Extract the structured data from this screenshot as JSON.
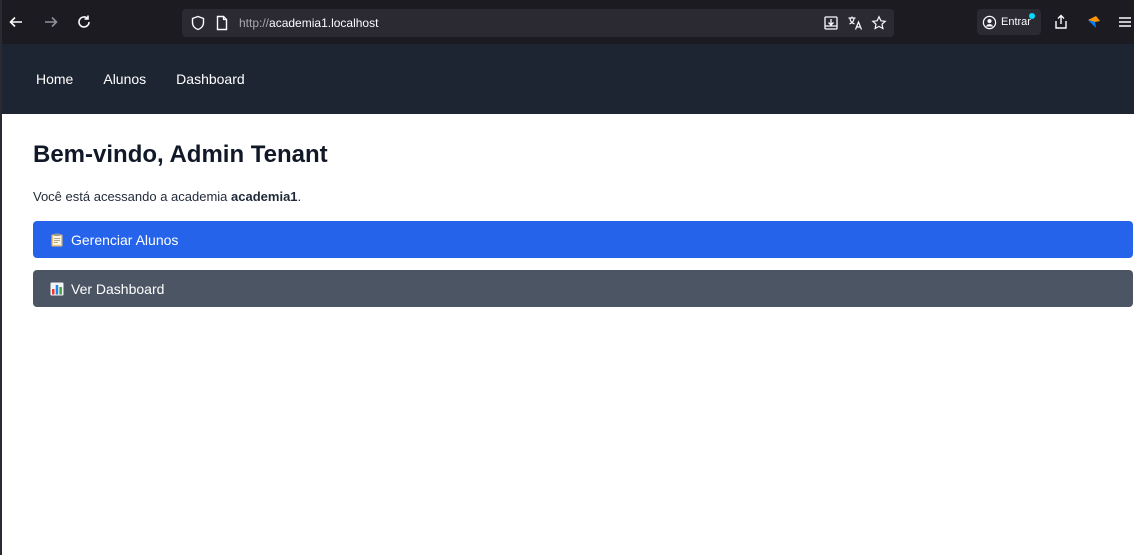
{
  "browser": {
    "url_scheme": "http://",
    "url_host": "academia1.localhost",
    "account_label": "Entrar",
    "icons": {
      "back": "back-arrow-icon",
      "forward": "forward-arrow-icon",
      "reload": "reload-icon",
      "tracking": "shield-icon",
      "page": "page-icon",
      "save": "save-icon",
      "translate": "translate-icon",
      "bookmark": "star-icon",
      "account": "account-icon",
      "share": "share-icon",
      "extension": "extension-icon",
      "menu": "hamburger-menu-icon"
    }
  },
  "nav": {
    "items": [
      {
        "label": "Home"
      },
      {
        "label": "Alunos"
      },
      {
        "label": "Dashboard"
      }
    ]
  },
  "main": {
    "title": "Bem-vindo, Admin Tenant",
    "welcome_prefix": "Você está acessando a academia ",
    "academy_name": "academia1",
    "welcome_suffix": ".",
    "buttons": {
      "manage_students": "Gerenciar Alunos",
      "view_dashboard": "Ver Dashboard"
    }
  },
  "colors": {
    "browser_bg": "#1c1b22",
    "navbar_bg": "#1e2532",
    "primary_button": "#2563eb",
    "secondary_button": "#4b5563"
  }
}
